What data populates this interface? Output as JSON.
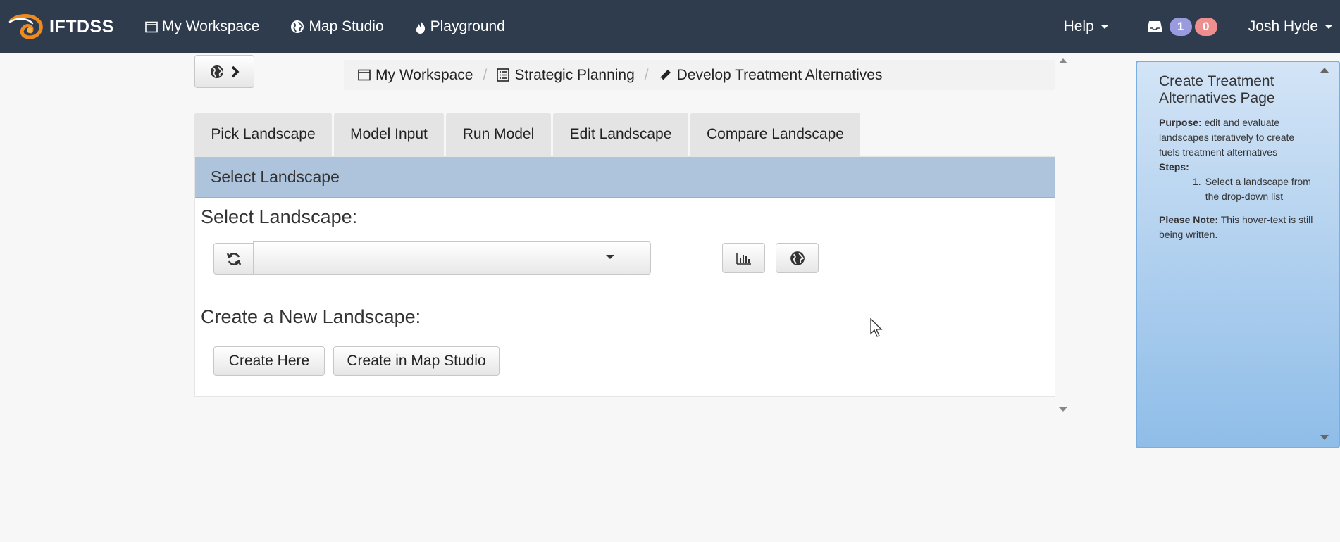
{
  "navbar": {
    "brand": "IFTDSS",
    "items": [
      {
        "label": "My Workspace",
        "icon": "window-icon"
      },
      {
        "label": "Map Studio",
        "icon": "globe-icon"
      },
      {
        "label": "Playground",
        "icon": "fire-icon"
      }
    ],
    "help_label": "Help",
    "notifications": {
      "icon": "inbox-icon",
      "count_a": "1",
      "count_b": "0"
    },
    "user_name": "Josh Hyde",
    "colors": {
      "bg": "#2e3c4e",
      "badge_a": "#9a9bde",
      "badge_b": "#ee8e8e"
    }
  },
  "breadcrumb": [
    {
      "label": "My Workspace",
      "icon": "window-icon"
    },
    {
      "label": "Strategic Planning",
      "icon": "list-icon"
    },
    {
      "label": "Develop Treatment Alternatives",
      "icon": "pencil-icon"
    }
  ],
  "breadcrumb_separator": "/",
  "tabs": [
    "Pick Landscape",
    "Model Input",
    "Run Model",
    "Edit Landscape",
    "Compare Landscape"
  ],
  "panel": {
    "heading": "Select Landscape",
    "select_label": "Select Landscape:",
    "select_value": "",
    "create_label": "Create a New Landscape:",
    "create_here_label": "Create Here",
    "create_map_studio_label": "Create in Map Studio",
    "heading_color": "#aec3dc"
  },
  "help": {
    "title": "Create Treatment Alternatives Page",
    "purpose_label": "Purpose:",
    "purpose_text": "edit and evaluate landscapes iteratively to create fuels treatment alternatives",
    "steps_label": "Steps:",
    "steps": [
      "Select a landscape from the drop-down list"
    ],
    "note_label": "Please Note:",
    "note_text": "This hover-text is still being written."
  }
}
